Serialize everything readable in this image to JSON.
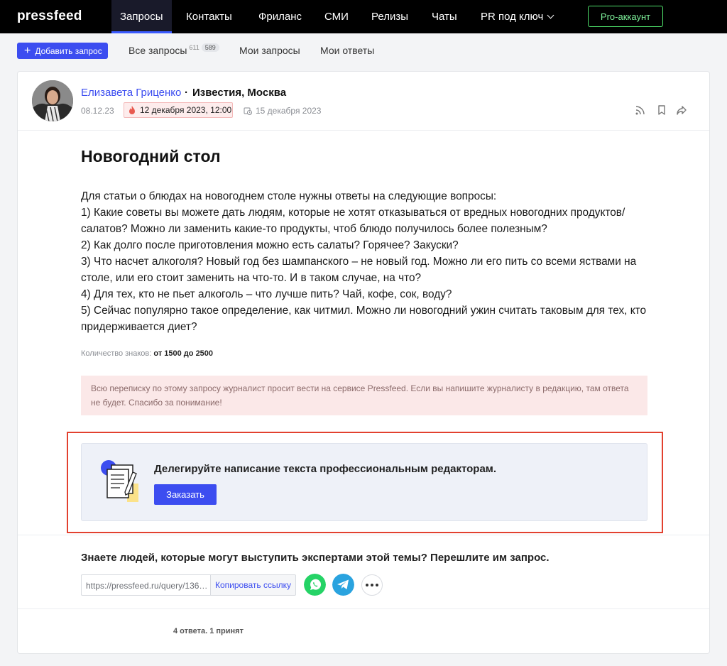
{
  "app": {
    "logo": "pressfeed"
  },
  "nav": {
    "items": [
      {
        "label": "Запросы"
      },
      {
        "label": "Контакты"
      },
      {
        "label": "Фриланс"
      },
      {
        "label": "СМИ"
      },
      {
        "label": "Релизы"
      },
      {
        "label": "Чаты"
      },
      {
        "label": "PR под ключ"
      }
    ],
    "pro_label": "Pro-аккаунт"
  },
  "subnav": {
    "add_label": "Добавить запрос",
    "all_label": "Все запросы",
    "all_count": "611",
    "all_new": "589",
    "mine_label": "Мои запросы",
    "answers_label": "Мои ответы"
  },
  "request": {
    "author": "Елизавета Гриценко",
    "dot": "·",
    "outlet": "Известия, Москва",
    "posted": "08.12.23",
    "deadline": "12 декабря 2023, 12:00",
    "publish_date": "15 декабря 2023",
    "title": "Новогодний стол",
    "body": [
      "Для статьи о блюдах на новогоднем столе нужны ответы на следующие вопросы:",
      "1) Какие советы вы можете дать людям, которые не хотят отказываться от вредных новогодних продуктов/ салатов? Можно ли заменить какие-то продукты, чтоб блюдо получилось более полезным?",
      "2) Как долго после приготовления можно есть салаты? Горячее? Закуски?",
      "3) Что насчет алкоголя? Новый год без шампанского – не новый год. Можно ли его пить со всеми яствами на столе, или его стоит заменить на что-то. И в таком случае, на что?",
      "4) Для тех, кто не пьет алкоголь – что лучше пить? Чай, кофе, сок, воду?",
      "5) Сейчас популярно такое определение, как читмил. Можно ли новогодний ужин считать таковым для тех, кто придерживается диет?"
    ],
    "chars_label": "Количество знаков:",
    "chars_value": "от 1500 до 2500",
    "notice": "Всю переписку по этому запросу журналист просит вести на сервисе Pressfeed. Если вы напишите журналисту в редакцию, там ответа не будет. Спасибо за понимание!"
  },
  "promo": {
    "text": "Делегируйте написание текста профессиональным редакторам.",
    "button": "Заказать"
  },
  "share": {
    "title": "Знаете людей, которые могут выступить экспертами этой темы? Перешлите им запрос.",
    "link": "https://pressfeed.ru/query/136…",
    "copy_label": "Копировать ссылку"
  },
  "footer": {
    "answers": "4 ответа. 1 принят"
  },
  "colors": {
    "accent": "#3c4df0",
    "pro": "#4ee06a",
    "highlight": "#e2412f",
    "whatsapp": "#25d366",
    "telegram": "#2aa3df"
  }
}
